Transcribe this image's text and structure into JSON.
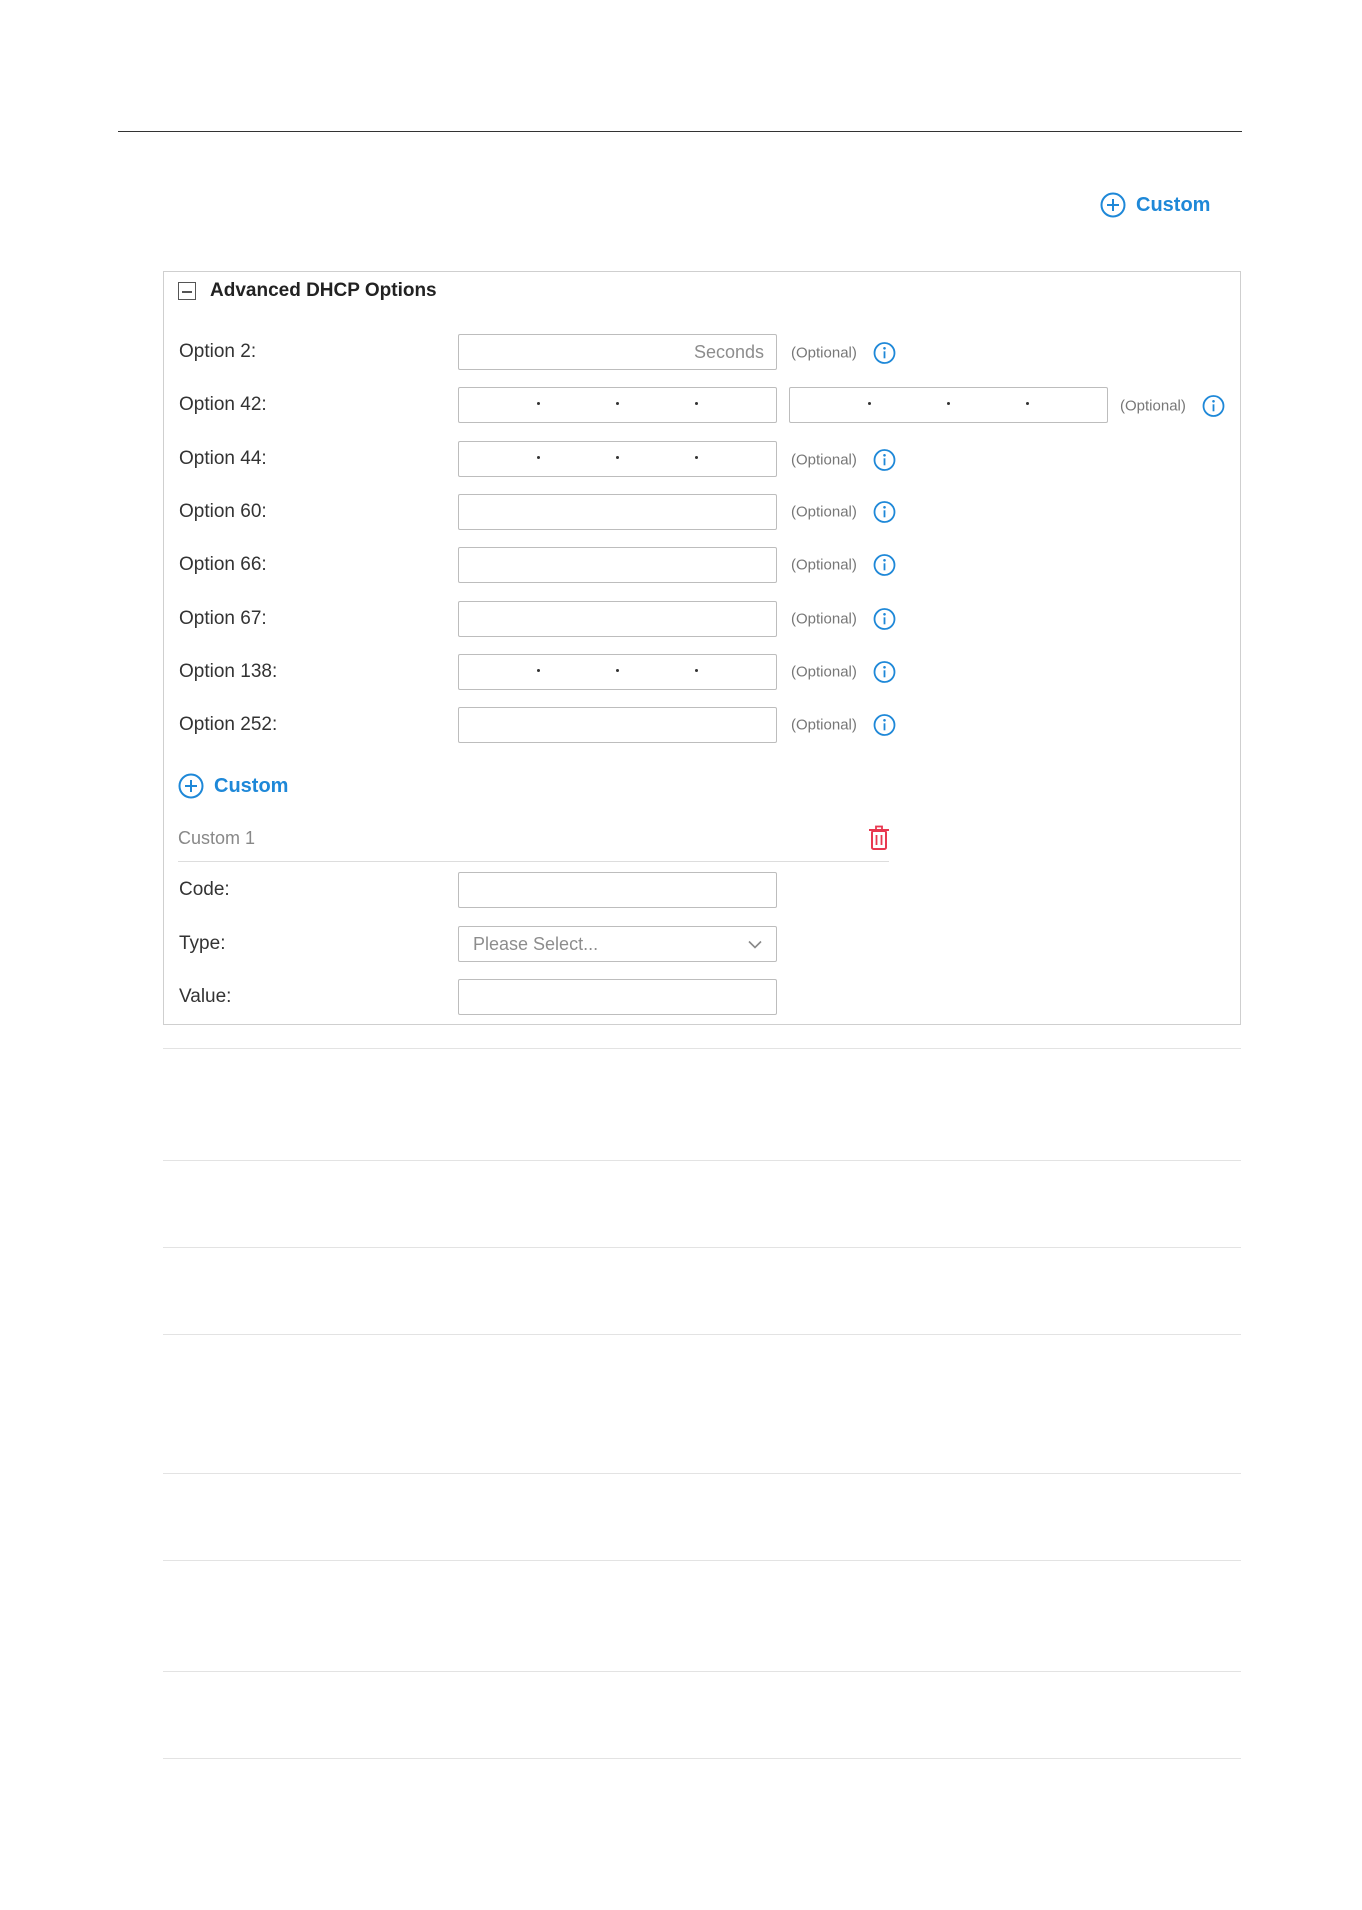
{
  "header": {
    "custom_label": "Custom"
  },
  "panel": {
    "title": "Advanced DHCP Options",
    "optional_text": "(Optional)",
    "options": [
      {
        "label": "Option 2:",
        "kind": "text",
        "placeholder": "Seconds"
      },
      {
        "label": "Option 42:",
        "kind": "ip-pair"
      },
      {
        "label": "Option 44:",
        "kind": "ip"
      },
      {
        "label": "Option 60:",
        "kind": "text",
        "placeholder": ""
      },
      {
        "label": "Option 66:",
        "kind": "text",
        "placeholder": ""
      },
      {
        "label": "Option 67:",
        "kind": "text",
        "placeholder": ""
      },
      {
        "label": "Option 138:",
        "kind": "ip"
      },
      {
        "label": "Option 252:",
        "kind": "text",
        "placeholder": ""
      }
    ],
    "custom_button_label": "Custom",
    "custom_entry": {
      "title": "Custom 1",
      "code_label": "Code:",
      "type_label": "Type:",
      "type_placeholder": "Please Select...",
      "value_label": "Value:"
    }
  },
  "icons": {
    "add": "plus-circle-icon",
    "collapse": "minus-square-icon",
    "info": "info-circle-icon",
    "delete": "trash-icon"
  },
  "colors": {
    "accent": "#1e88d8",
    "danger": "#e8374f",
    "border": "#bdbdbd"
  }
}
